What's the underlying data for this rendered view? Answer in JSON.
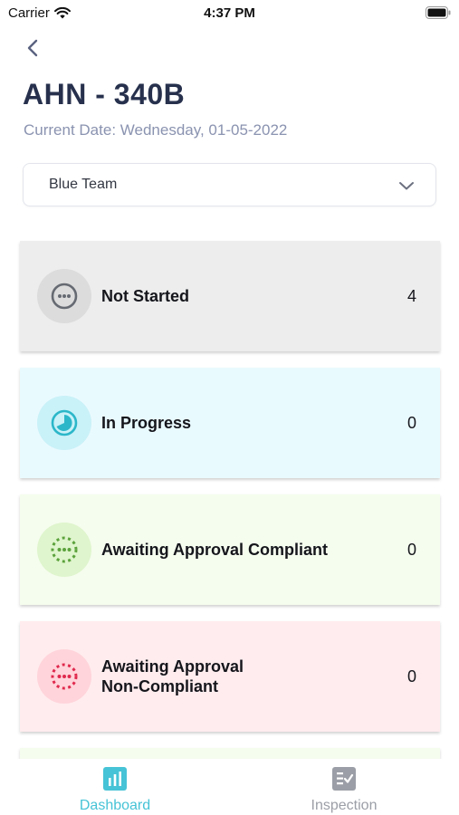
{
  "status_bar": {
    "carrier": "Carrier",
    "time": "4:37 PM"
  },
  "header": {
    "title": "AHN - 340B",
    "date_line": "Current Date: Wednesday, 01-05-2022"
  },
  "team_select": {
    "value": "Blue Team"
  },
  "cards": [
    {
      "label": "Not Started",
      "count": "4",
      "icon": "dots-circle-icon",
      "color": "#666a72",
      "bg": "#ededed",
      "icon_bg": "#dcdcdc"
    },
    {
      "label": "In Progress",
      "count": "0",
      "icon": "progress-circle-icon",
      "color": "#2bb7c9",
      "bg": "#e9fafe",
      "icon_bg": "#c9f1f8"
    },
    {
      "label": "Awaiting Approval Compliant",
      "count": "0",
      "icon": "dashed-circle-icon",
      "color": "#5ba23c",
      "bg": "#f5fdee",
      "icon_bg": "#dff5cd"
    },
    {
      "label_line1": "Awaiting Approval",
      "label_line2": "Non-Compliant",
      "count": "0",
      "icon": "dashed-circle-icon",
      "color": "#e0294d",
      "bg": "#ffecee",
      "icon_bg": "#ffd4da"
    }
  ],
  "tab_bar": {
    "tabs": [
      {
        "label": "Dashboard",
        "icon": "bar-chart-icon",
        "active": true,
        "color": "#46c3d6"
      },
      {
        "label": "Inspection",
        "icon": "checklist-icon",
        "active": false,
        "color": "#9b9ea6"
      }
    ]
  }
}
